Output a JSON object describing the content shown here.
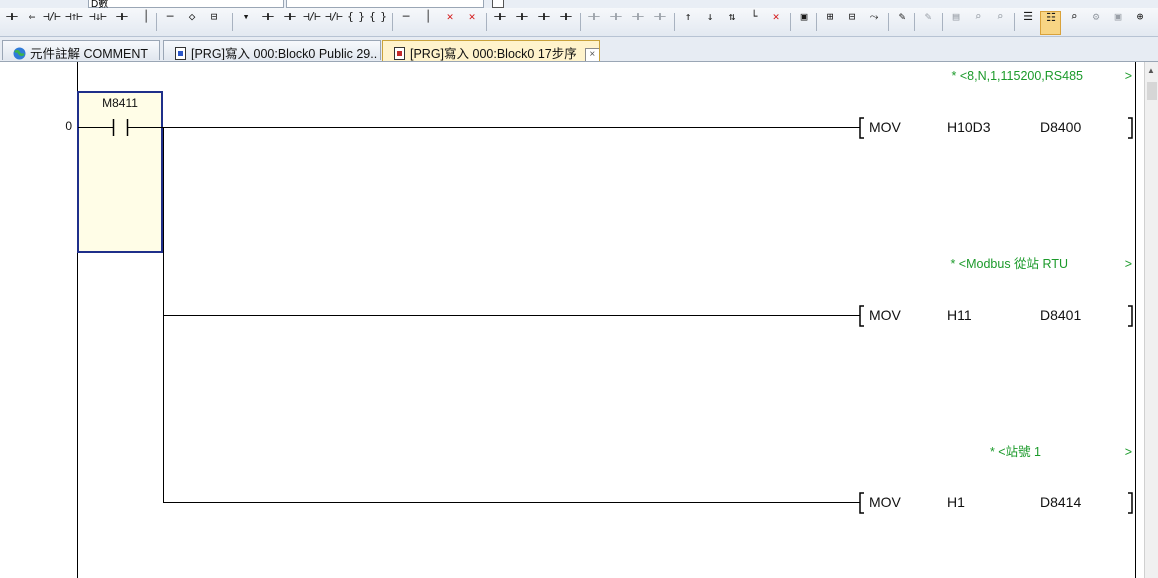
{
  "combo": {
    "value": "D數"
  },
  "tabs": [
    {
      "label": "元件註解 COMMENT",
      "active": false
    },
    {
      "label": "[PRG]寫入 000:Block0 Public 29..",
      "active": false
    },
    {
      "label": "[PRG]寫入 000:Block0 17步序",
      "active": true
    }
  ],
  "tab_close": "×",
  "tab_nav": "◀ ▶",
  "ladder": {
    "step_number": "0",
    "contact_label": "M8411",
    "rungs": [
      {
        "comment": "* <8,N,1,115200,RS485",
        "comment_end": ">",
        "instr": "MOV",
        "op1": "H10D3",
        "op2": "D8400"
      },
      {
        "comment": "* <Modbus 從站 RTU",
        "comment_end": ">",
        "instr": "MOV",
        "op1": "H11",
        "op2": "D8401"
      },
      {
        "comment": "* <站號 1",
        "comment_end": ">",
        "instr": "MOV",
        "op1": "H1",
        "op2": "D8414"
      }
    ]
  },
  "colors": {
    "comment_green": "#1b9a2a",
    "selection_border": "#1f2f8a",
    "active_tab": "#fff3cc"
  }
}
